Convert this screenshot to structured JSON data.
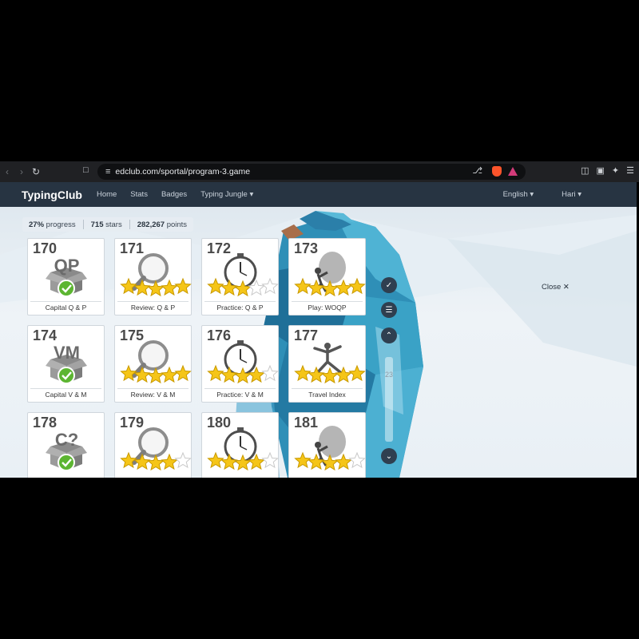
{
  "browser": {
    "url": "edclub.com/sportal/program-3.game"
  },
  "navbar": {
    "brand": "TypingClub",
    "links": [
      "Home",
      "Stats",
      "Badges",
      "Typing Jungle ▾"
    ],
    "language": "English ▾",
    "user": "Hari ▾"
  },
  "stats": {
    "progress_value": "27%",
    "progress_label": "progress",
    "stars_value": "715",
    "stars_label": "stars",
    "points_value": "282,267",
    "points_label": "points"
  },
  "lessons": [
    {
      "num": "170",
      "label": "Capital Q & P",
      "type": "box",
      "letters": "QP",
      "stars": null
    },
    {
      "num": "171",
      "label": "Review: Q & P",
      "type": "magnifier",
      "stars": 5
    },
    {
      "num": "172",
      "label": "Practice: Q & P",
      "type": "stopwatch",
      "stars": 3
    },
    {
      "num": "173",
      "label": "Play: WOQP",
      "type": "boulder",
      "stars": 5
    },
    {
      "num": "174",
      "label": "Capital V & M",
      "type": "box",
      "letters": "VM",
      "stars": null
    },
    {
      "num": "175",
      "label": "Review: V & M",
      "type": "magnifier",
      "stars": 5
    },
    {
      "num": "176",
      "label": "Practice: V & M",
      "type": "stopwatch",
      "stars": 4
    },
    {
      "num": "177",
      "label": "Travel Index",
      "type": "runner",
      "stars": 5
    },
    {
      "num": "178",
      "label": "",
      "type": "box",
      "letters": "C?",
      "stars": null
    },
    {
      "num": "179",
      "label": "",
      "type": "magnifier",
      "stars": 4
    },
    {
      "num": "180",
      "label": "",
      "type": "stopwatch",
      "stars": 4
    },
    {
      "num": "181",
      "label": "",
      "type": "boulder",
      "stars": 4
    }
  ],
  "controls": {
    "page_number": "23",
    "close_label": "Close ✕"
  },
  "colors": {
    "navbar": "#273442",
    "star": "#f5c518",
    "check": "#5cb531"
  }
}
